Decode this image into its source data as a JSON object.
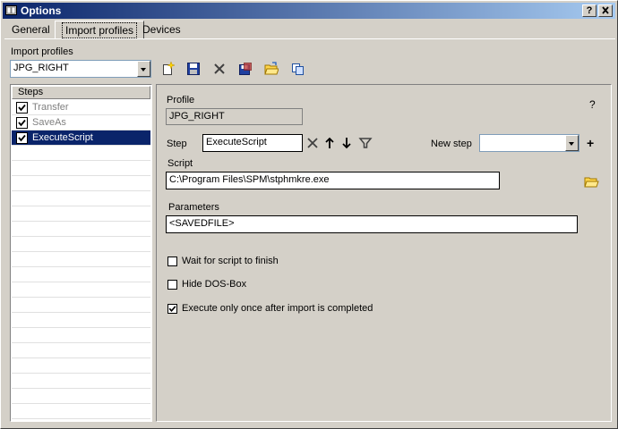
{
  "window": {
    "title": "Options",
    "help_btn": "?",
    "close_btn": "X"
  },
  "tabs": [
    {
      "label": "General",
      "active": false
    },
    {
      "label": "Import profiles",
      "active": true
    },
    {
      "label": "Devices",
      "active": false
    }
  ],
  "import_profiles": {
    "label": "Import profiles",
    "selected": "JPG_RIGHT",
    "toolbar": [
      "new-icon",
      "save-icon",
      "delete-icon",
      "save-as-icon",
      "open-folder-icon",
      "copy-icon"
    ]
  },
  "steps": {
    "header": "Steps",
    "items": [
      {
        "label": "Transfer",
        "checked": true,
        "selected": false
      },
      {
        "label": "SaveAs",
        "checked": true,
        "selected": false
      },
      {
        "label": "ExecuteScript",
        "checked": true,
        "selected": true
      }
    ]
  },
  "panel": {
    "profile_label": "Profile",
    "profile_value": "JPG_RIGHT",
    "help": "?",
    "step_label": "Step",
    "step_value": "ExecuteScript",
    "new_step_label": "New step",
    "new_step_value": "",
    "add": "+",
    "script_label": "Script",
    "script_value": "C:\\Program Files\\SPM\\stphmkre.exe",
    "parameters_label": "Parameters",
    "parameters_value": "<SAVEDFILE>",
    "options": [
      {
        "label": "Wait for script to finish",
        "checked": false
      },
      {
        "label": "Hide DOS-Box",
        "checked": false
      },
      {
        "label": "Execute only once after import is completed",
        "checked": true
      }
    ]
  },
  "colors": {
    "title_start": "#0a246a",
    "title_end": "#a6caf0",
    "selection": "#0a246a",
    "face": "#d4d0c8"
  }
}
